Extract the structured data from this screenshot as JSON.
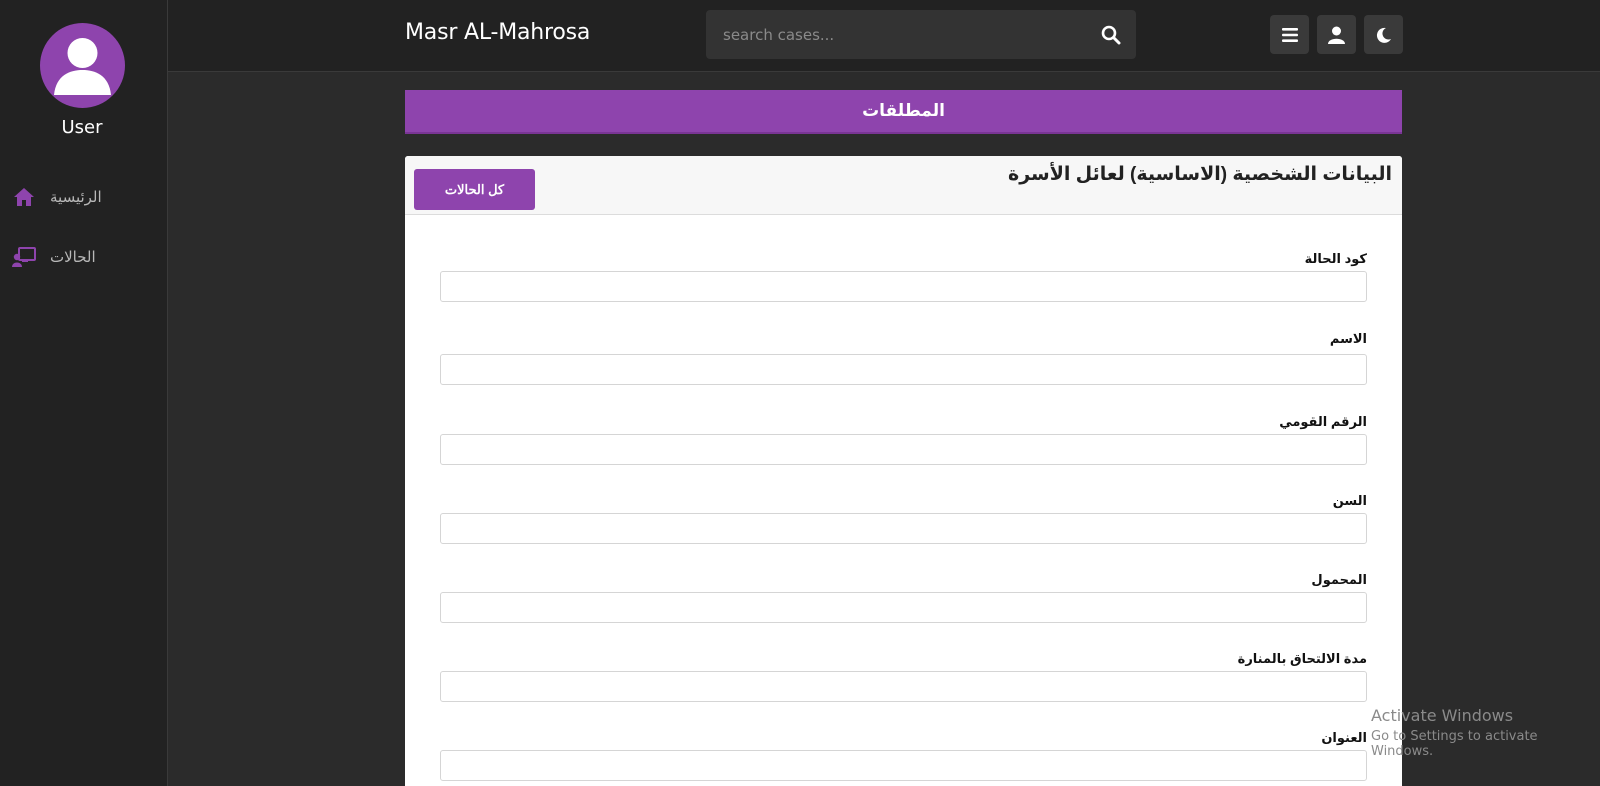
{
  "sidebar": {
    "user_name": "User",
    "items": [
      {
        "label": "الرئيسية",
        "icon": "home-icon"
      },
      {
        "label": "الحالات",
        "icon": "cases-icon"
      }
    ]
  },
  "header": {
    "brand": "Masr AL-Mahrosa",
    "search_placeholder": "search cases...",
    "buttons": [
      "menu-icon",
      "user-icon",
      "moon-icon"
    ]
  },
  "main": {
    "banner": "المطلقات",
    "card_title": "البيانات الشخصية (الاساسية) لعائل الأسرة",
    "all_cases_button": "كل الحالات",
    "fields": [
      {
        "label": "كود الحالة",
        "value": ""
      },
      {
        "label": "الاسم",
        "value": ""
      },
      {
        "label": "الرقم القومي",
        "value": ""
      },
      {
        "label": "السن",
        "value": ""
      },
      {
        "label": "المحمول",
        "value": ""
      },
      {
        "label": "مدة الالتحاق بالمنارة",
        "value": ""
      },
      {
        "label": "العنوان",
        "value": ""
      }
    ]
  },
  "watermark": {
    "line1": "Activate Windows",
    "line2": "Go to Settings to activate Windows."
  },
  "colors": {
    "accent": "#8e44ad",
    "sidebar_bg": "#222222",
    "page_bg": "#2b2b2b"
  }
}
